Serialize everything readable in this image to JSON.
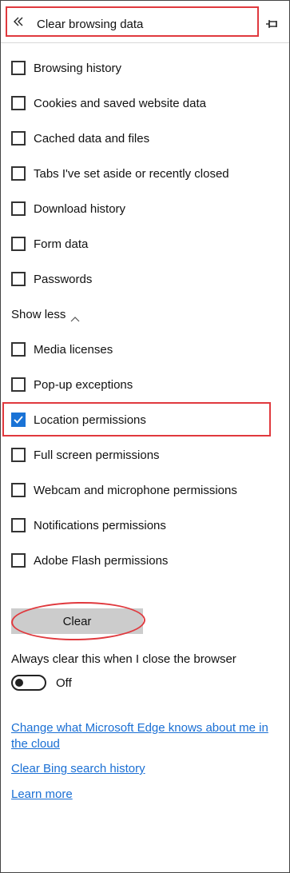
{
  "header": {
    "title": "Clear browsing data",
    "back_icon": "double-chevron-left-icon",
    "pin_icon": "pin-icon"
  },
  "checkboxes": [
    {
      "label": "Browsing history",
      "checked": false
    },
    {
      "label": "Cookies and saved website data",
      "checked": false
    },
    {
      "label": "Cached data and files",
      "checked": false
    },
    {
      "label": "Tabs I've set aside or recently closed",
      "checked": false
    },
    {
      "label": "Download history",
      "checked": false
    },
    {
      "label": "Form data",
      "checked": false
    },
    {
      "label": "Passwords",
      "checked": false
    }
  ],
  "show_less": "Show less",
  "more_checkboxes": [
    {
      "label": "Media licenses",
      "checked": false
    },
    {
      "label": "Pop-up exceptions",
      "checked": false
    },
    {
      "label": "Location permissions",
      "checked": true
    },
    {
      "label": "Full screen permissions",
      "checked": false
    },
    {
      "label": "Webcam and microphone permissions",
      "checked": false
    },
    {
      "label": "Notifications permissions",
      "checked": false
    },
    {
      "label": "Adobe Flash permissions",
      "checked": false
    }
  ],
  "clear_button": "Clear",
  "always_clear": {
    "label": "Always clear this when I close the browser",
    "state": "Off"
  },
  "links": {
    "cloud": "Change what Microsoft Edge knows about me in the cloud",
    "bing": "Clear Bing search history",
    "learn": "Learn more"
  },
  "colors": {
    "accent": "#1a73d6",
    "highlight": "#e0393e",
    "link": "#1a6fd4"
  }
}
